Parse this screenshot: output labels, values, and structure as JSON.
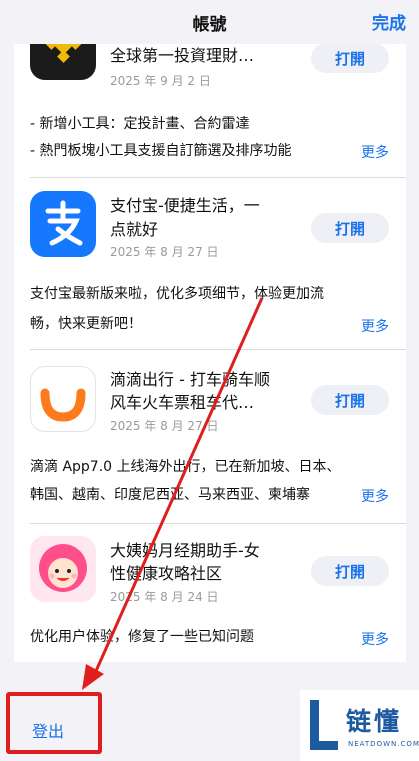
{
  "header": {
    "title": "帳號",
    "done_label": "完成"
  },
  "apps": [
    {
      "name_line1": "全球第一投資理財…",
      "name_line2": "",
      "date": "2025 年 9 月 2 日",
      "button": "打開",
      "notes": [
        "- 新增小工具：定投計畫、合約雷達",
        "- 熱門板塊小工具支援自訂篩選及排序功能"
      ],
      "more": "更多",
      "icon": "binance-icon"
    },
    {
      "name_line1": "支付宝-便捷生活，一",
      "name_line2": "点就好",
      "date": "2025 年 8 月 27 日",
      "button": "打開",
      "notes": [
        "支付宝最新版来啦，优化多项细节，体验更加流",
        "畅，快来更新吧！"
      ],
      "more": "更多",
      "icon": "alipay-icon"
    },
    {
      "name_line1": "滴滴出行 - 打车骑车顺",
      "name_line2": "风车火车票租车代…",
      "date": "2025 年 8 月 27 日",
      "button": "打開",
      "notes": [
        "滴滴 App7.0 上线海外出行，已在新加坡、日本、",
        "韩国、越南、印度尼西亚、马来西亚、柬埔寨"
      ],
      "more": "更多",
      "icon": "didi-icon"
    },
    {
      "name_line1": "大姨妈月经期助手-女",
      "name_line2": "性健康攻略社区",
      "date": "2025 年 8 月 24 日",
      "button": "打開",
      "notes": [
        "优化用户体验，修复了一些已知问题"
      ],
      "more": "更多",
      "icon": "dayima-icon"
    }
  ],
  "logout_label": "登出",
  "watermark": {
    "text": "链懂",
    "sub": "NEATDOWN.COM"
  },
  "colors": {
    "accent": "#1a73e8",
    "highlight": "#e01e1e",
    "background": "#f2f2f7"
  }
}
